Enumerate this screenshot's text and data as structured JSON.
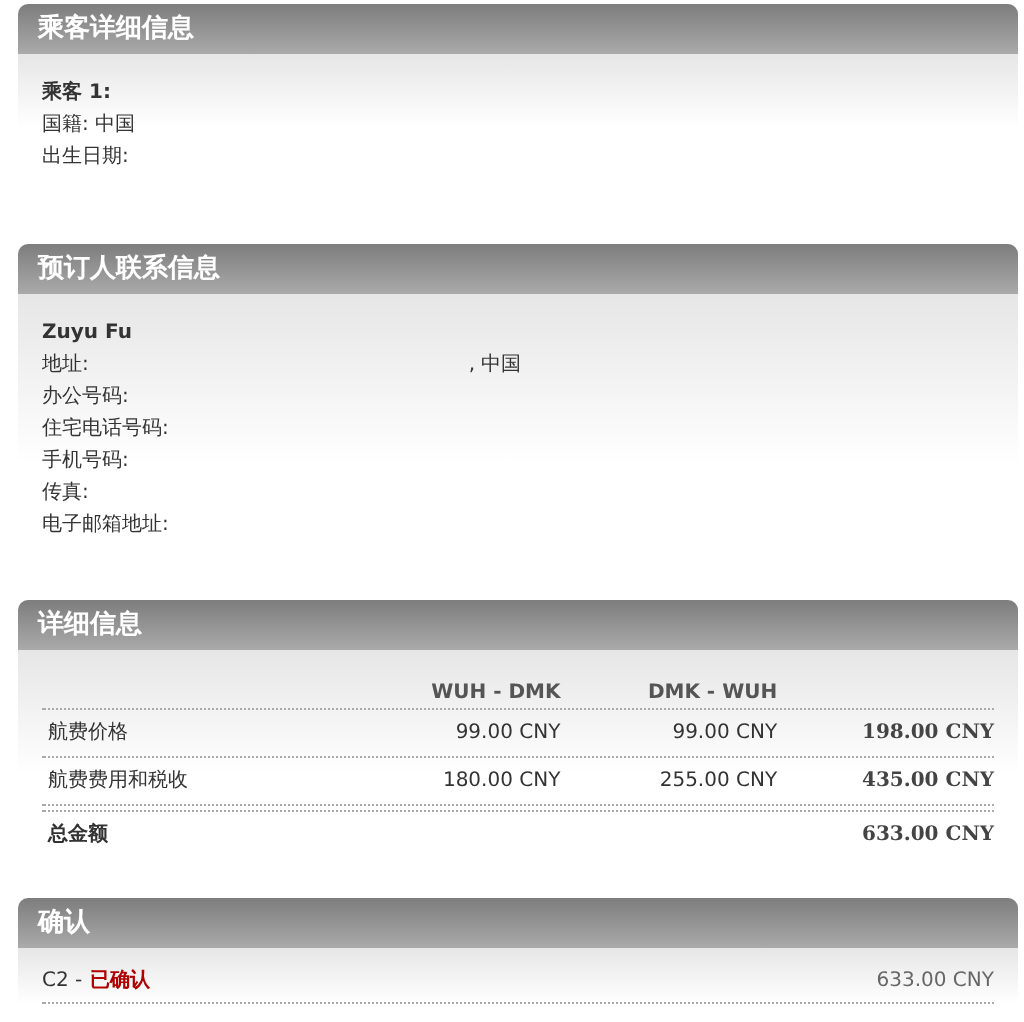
{
  "passenger": {
    "title": "乘客详细信息",
    "name_label": "乘客 1:",
    "nationality": "国籍: 中国",
    "birth_date_label": "出生日期:"
  },
  "contact": {
    "title": "预订人联系信息",
    "name": "Zuyu Fu",
    "address_label": "地址:",
    "address_end": ", 中国",
    "lines": [
      "办公号码:",
      "住宅电话号码:",
      "手机号码:",
      "传真:",
      "电子邮箱地址:"
    ]
  },
  "details": {
    "title": "详细信息",
    "columns": [
      "WUH - DMK",
      "DMK - WUH"
    ],
    "rows": [
      {
        "label": "航费价格",
        "cells": [
          "99.00 CNY",
          "99.00 CNY"
        ],
        "total": "198.00 CNY"
      },
      {
        "label": "航费费用和税收",
        "cells": [
          "180.00 CNY",
          "255.00 CNY"
        ],
        "total": "435.00 CNY"
      }
    ],
    "total_label": "总金额",
    "total": "633.00 CNY"
  },
  "confirmation": {
    "title": "确认",
    "code": "C2 -",
    "status": "已确认",
    "amount": "633.00 CNY"
  }
}
